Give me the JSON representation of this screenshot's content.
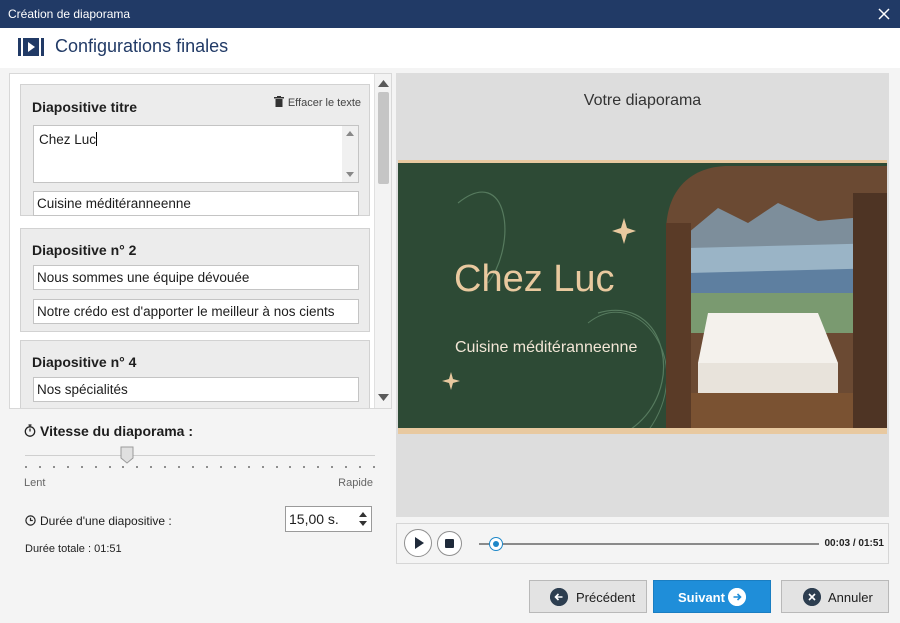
{
  "window": {
    "title": "Création de diaporama"
  },
  "header": {
    "title": "Configurations finales"
  },
  "slides_panel": {
    "clear_text_label": "Effacer le texte",
    "cards": [
      {
        "heading": "Diapositive titre",
        "title_value": "Chez Luc",
        "subtitle_value": "Cuisine méditéranneenne"
      },
      {
        "heading": "Diapositive n° 2",
        "line1": "Nous sommes une équipe dévouée",
        "line2": "Notre crédo est d'apporter le meilleur à nos cients"
      },
      {
        "heading": "Diapositive n° 4",
        "line1": "Nos spécialités"
      }
    ]
  },
  "speed": {
    "title": "Vitesse du diaporama :",
    "min_label": "Lent",
    "max_label": "Rapide",
    "slider_position": 0.29,
    "slide_duration_label": "Durée d'une diapositive :",
    "slide_duration_value": "15,00 s.",
    "total_duration": "Durée totale : 01:51"
  },
  "preview": {
    "title": "Votre diaporama",
    "slide_title": "Chez Luc",
    "slide_subtitle": "Cuisine méditéranneenne"
  },
  "player": {
    "time": "00:03 / 01:51",
    "progress": 0.03
  },
  "footer": {
    "prev_label": "Précédent",
    "next_label": "Suivant",
    "cancel_label": "Annuler"
  },
  "colors": {
    "titlebar": "#213a66",
    "accent": "#1f8ed9",
    "slide_bg": "#2d4a35",
    "slide_text": "#e9c99f"
  }
}
